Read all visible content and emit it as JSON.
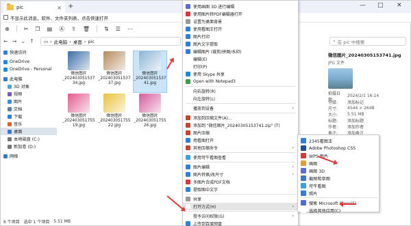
{
  "window": {
    "tab_title": "pic",
    "tab_close": "×",
    "new_tab": "+",
    "min": "—",
    "max": "□",
    "close": "✕"
  },
  "notice": "不显示此消息，软件、文件夹列表，点击快速打开",
  "address": {
    "path": [
      "此电脑",
      "桌面",
      "pic"
    ],
    "search_placeholder": "在 pic 中搜索"
  },
  "sidebar": {
    "items": [
      {
        "label": "快速访问",
        "color": "#2f7fd8"
      },
      {
        "label": "OneDrive",
        "color": "#1e88e5"
      },
      {
        "label": "OneDrive - Personal",
        "color": "#1e88e5"
      },
      {
        "label": "此电脑",
        "color": "#3a78c9"
      },
      {
        "label": "3D 对象",
        "color": "#4aa3df"
      },
      {
        "label": "视频",
        "color": "#7d5ab5"
      },
      {
        "label": "图片",
        "color": "#3d8fd1"
      },
      {
        "label": "文档",
        "color": "#5a7fa6"
      },
      {
        "label": "下载",
        "color": "#2f7fd8"
      },
      {
        "label": "音乐",
        "color": "#e0612b"
      },
      {
        "label": "桌面",
        "color": "#3a78c9"
      },
      {
        "label": "本地磁盘 (C:)",
        "color": "#777777"
      },
      {
        "label": "新加卷 (D:)",
        "color": "#777777"
      },
      {
        "label": "网络",
        "color": "#3a78c9"
      }
    ],
    "selected_index": 10
  },
  "files": [
    {
      "name": "微信图片_202403051537 34.jpg",
      "color": "#3b6ea8"
    },
    {
      "name": "微信图片_202403051537 37.jpg",
      "color": "#b58a5e"
    },
    {
      "name": "微信图片_202403051537 41.jpg",
      "color": "#8db5d6"
    },
    {
      "name": "微信图片_202403051755 19.jpg",
      "color": "#e35b8f"
    },
    {
      "name": "微信图片_202403051755 22.jpg",
      "color": "#e8c23a"
    },
    {
      "name": "微信图片_202403051755 26.jpg",
      "color": "#d45a9c"
    }
  ],
  "detail": {
    "title": "微信图片_20240305153741.jpg",
    "type": "JPG 文件",
    "rows": [
      {
        "k": "拍摄日期:",
        "v": "2024/2/1 16:14"
      },
      {
        "k": "分级:",
        "v": "添加标记"
      },
      {
        "k": "尺寸:",
        "v": "4544 × 2648"
      },
      {
        "k": "大小:",
        "v": "5.51 MB"
      },
      {
        "k": "标题:",
        "v": "添加标题"
      },
      {
        "k": "作者:",
        "v": "添加作者"
      },
      {
        "k": "备注:",
        "v": "添加备注"
      },
      {
        "k": "标签:",
        "v": "添加标记"
      }
    ]
  },
  "status": {
    "count": "6 个项目",
    "selected": "选中 1 个项目",
    "size": "5.51 MB"
  },
  "context_menu": {
    "items": [
      {
        "label": "使用画图 3D 进行编辑",
        "color": "#5b6bd6"
      },
      {
        "label": "使用图片转PDF编辑器打开",
        "color": "#d9363e"
      },
      {
        "label": "设置为桌面背景",
        "color": "#999999"
      },
      {
        "label": "使用看图王打开",
        "color": "#2f7fd8"
      },
      {
        "label": "图片打印",
        "color": "#2f7fd8"
      },
      {
        "label": "图片文字提取",
        "color": "#2f7fd8"
      },
      {
        "label": "编辑图片 (裁剪/拼图/水印)",
        "color": "#2f7fd8"
      },
      {
        "label": "编辑(E)",
        "color": "#ffffff"
      },
      {
        "label": "打印(P)",
        "color": "#ffffff"
      },
      {
        "label": "使用 Skype 共享",
        "color": "#1e88e5"
      },
      {
        "label": "Open with Notepad3",
        "color": "#3a9f46"
      },
      {
        "label": "向右旋转(R)",
        "color": "#ffffff"
      },
      {
        "label": "向左旋转(L)",
        "color": "#ffffff"
      },
      {
        "label": "播放到设备",
        "color": "#ffffff",
        "arrow": true
      },
      {
        "label": "添加到压缩文件(A)...",
        "color": "#c2462f"
      },
      {
        "label": "添加到 \"微信图片_20240305153741.zip\" (T)",
        "color": "#c2462f"
      },
      {
        "label": "图片压缩",
        "color": "#c2462f"
      },
      {
        "label": "用看图打开",
        "color": "#2f7fd8"
      },
      {
        "label": "其他压缩命令",
        "color": "#c2462f",
        "arrow": true
      },
      {
        "label": "使用可牛看图查看",
        "color": "#3aa1dc"
      },
      {
        "label": "图片编辑",
        "color": "#2f7fd8",
        "arrow": true
      },
      {
        "label": "图片转换/改尺寸",
        "color": "#2f7fd8",
        "arrow": true
      },
      {
        "label": "多图片合成PDF文档",
        "color": "#d9363e"
      },
      {
        "label": "提取图中文字",
        "color": "#2f7fd8"
      },
      {
        "label": "共享",
        "color": "#999999"
      },
      {
        "label": "打开方式(H)",
        "color": "#ffffff",
        "arrow": true,
        "highlight": true
      },
      {
        "label": "授予访问权限(G)",
        "color": "#ffffff",
        "arrow": true
      },
      {
        "label": "上传到百度网盘",
        "color": "#2f7fd8"
      }
    ]
  },
  "submenu": {
    "items": [
      {
        "label": "2345看图王",
        "color": "#2f7fd8"
      },
      {
        "label": "Adobe Photoshop CS5",
        "color": "#1e4f8f"
      },
      {
        "label": "WPS 图片",
        "color": "#d9363e"
      },
      {
        "label": "画图",
        "color": "#e0a12b"
      },
      {
        "label": "画图 3D",
        "color": "#5b6bd6"
      },
      {
        "label": "截图和草图",
        "color": "#3a78c9"
      },
      {
        "label": "可牛看图",
        "color": "#3aa1dc"
      },
      {
        "label": "照片",
        "color": "#2f7fd8"
      },
      {
        "label": "搜索 Microsoft Store(S)",
        "color": "#4c6fd6"
      },
      {
        "label": "选择其他应用(C)",
        "color": "#ffffff"
      }
    ]
  }
}
